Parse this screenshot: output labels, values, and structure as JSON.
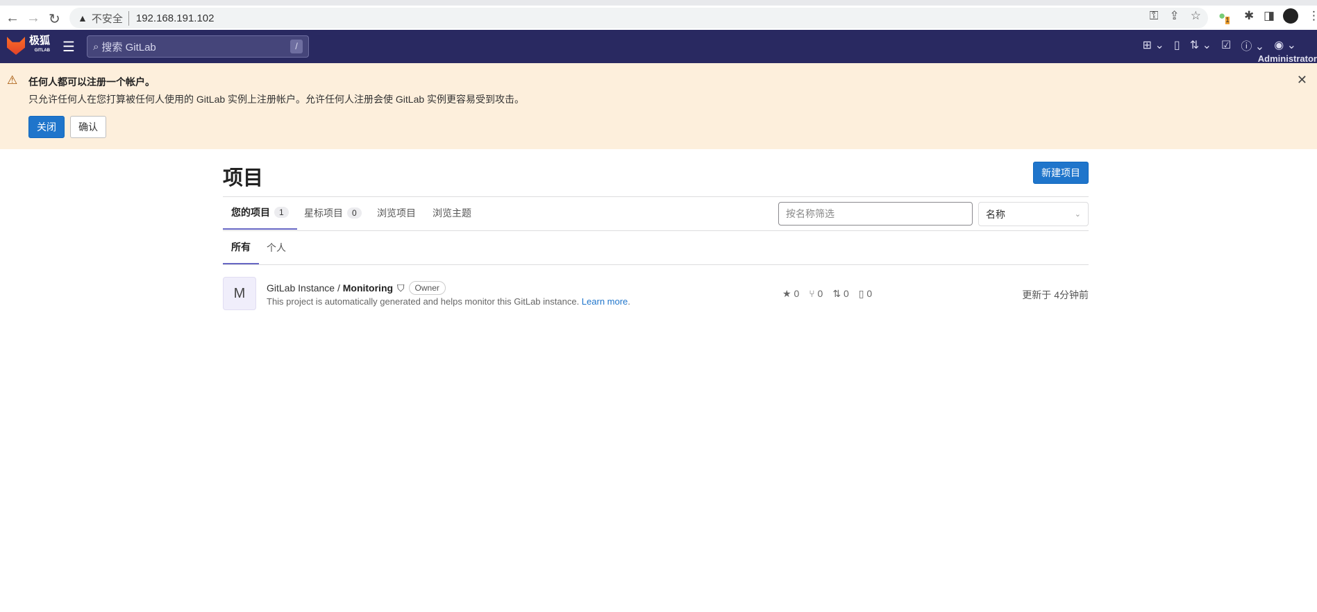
{
  "browser": {
    "security": "不安全",
    "url": "192.168.191.102",
    "ext_badge": "1"
  },
  "nav": {
    "logo_text": "极狐",
    "logo_sub": "GITLAB",
    "search_placeholder": "搜索 GitLab",
    "search_shortcut": "/",
    "user": "Administrator"
  },
  "banner": {
    "title": "任何人都可以注册一个帐户。",
    "message": "只允许任何人在您打算被任何人使用的 GitLab 实例上注册帐户。允许任何人注册会使 GitLab 实例更容易受到攻击。",
    "close_label": "关闭",
    "confirm_label": "确认"
  },
  "page": {
    "title": "项目",
    "new_project": "新建项目"
  },
  "tabs": [
    {
      "label": "您的项目",
      "count": "1"
    },
    {
      "label": "星标项目",
      "count": "0"
    },
    {
      "label": "浏览项目"
    },
    {
      "label": "浏览主题"
    }
  ],
  "filter": {
    "placeholder": "按名称筛选",
    "sort": "名称"
  },
  "subtabs": [
    "所有",
    "个人"
  ],
  "project": {
    "avatar": "M",
    "namespace": "GitLab Instance / ",
    "name": "Monitoring",
    "role": "Owner",
    "description": "This project is automatically generated and helps monitor this GitLab instance. ",
    "learn_more": "Learn more",
    "stars": "0",
    "forks": "0",
    "merge_requests": "0",
    "issues": "0",
    "updated": "更新于 4分钟前"
  }
}
